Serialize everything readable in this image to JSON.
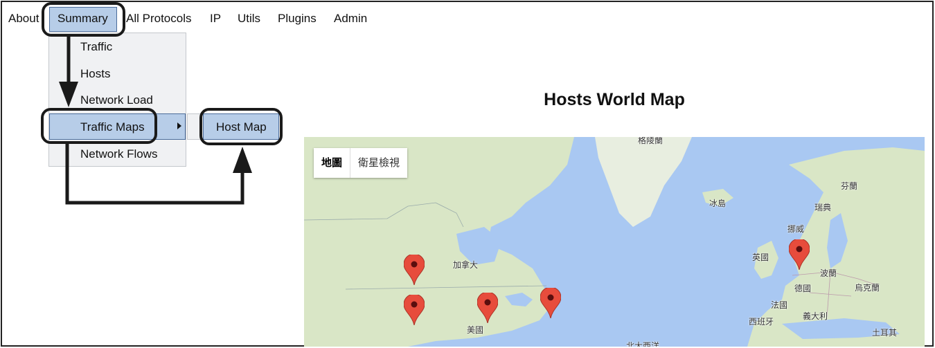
{
  "nav": {
    "items": [
      "About",
      "Summary",
      "All Protocols",
      "IP",
      "Utils",
      "Plugins",
      "Admin"
    ]
  },
  "dropdown": {
    "items": [
      "Traffic",
      "Hosts",
      "Network Load",
      "Traffic Maps",
      "Network Flows"
    ],
    "active": "Traffic Maps"
  },
  "submenu": {
    "item": "Host Map"
  },
  "page": {
    "title": "Hosts World Map"
  },
  "map": {
    "type_toggle": [
      "地圖",
      "衛星檢視"
    ],
    "selected_type": "地圖",
    "labels": [
      "格陵蘭",
      "冰島",
      "芬蘭",
      "瑞典",
      "挪威",
      "加拿大",
      "英國",
      "波蘭",
      "德國",
      "烏克蘭",
      "法國",
      "義大利",
      "西班牙",
      "土耳其",
      "美國",
      "北大西洋"
    ],
    "marker_count": 5
  },
  "colors": {
    "highlight": "#b7cde8",
    "marker": "#e74c3c",
    "water": "#a9c8f2",
    "land": "#d9e6c6"
  }
}
